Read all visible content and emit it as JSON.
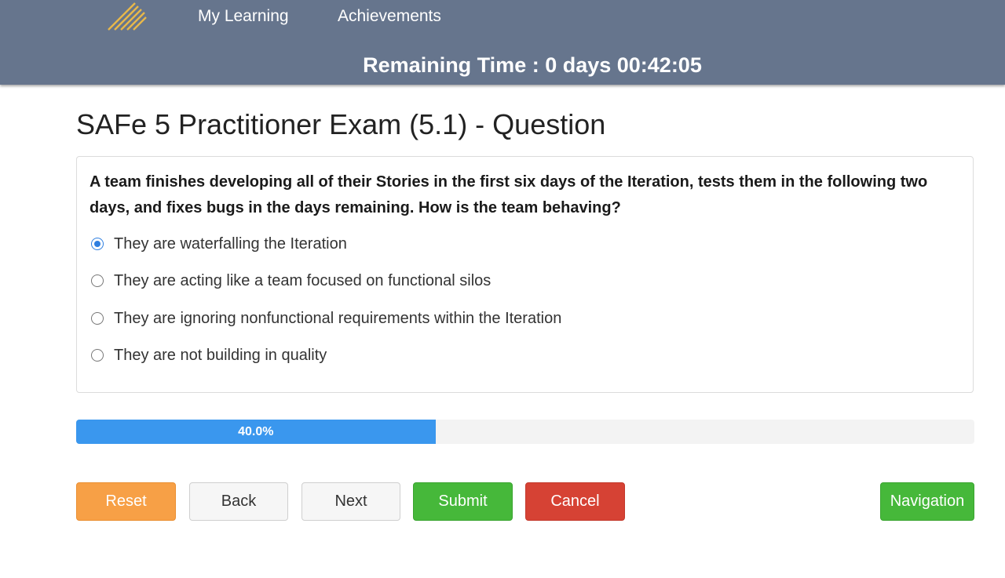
{
  "header": {
    "nav": [
      "My Learning",
      "Achievements"
    ],
    "timer": "Remaining Time : 0 days 00:42:05"
  },
  "main": {
    "title": "SAFe 5 Practitioner Exam (5.1) - Question",
    "question": "A team finishes developing all of their Stories in the first six days of the Iteration, tests them in the following two days, and fixes bugs in the days remaining. How is the team behaving?",
    "options": [
      "They are waterfalling the Iteration",
      "They are acting like a team focused on functional silos",
      "They are ignoring nonfunctional requirements within the Iteration",
      "They are not building in quality"
    ],
    "selected_index": 0,
    "progress": {
      "percent": 40.0,
      "label": "40.0%"
    },
    "buttons": {
      "reset": "Reset",
      "back": "Back",
      "next": "Next",
      "submit": "Submit",
      "cancel": "Cancel",
      "navigation": "Navigation"
    }
  },
  "colors": {
    "header_bg": "#66758d",
    "progress": "#3a97ee",
    "reset": "#f7a046",
    "submit": "#46b83a",
    "cancel": "#d64234",
    "logo": "#e8b84a"
  },
  "icons": {
    "logo": "diagonal-stripes-logo"
  }
}
